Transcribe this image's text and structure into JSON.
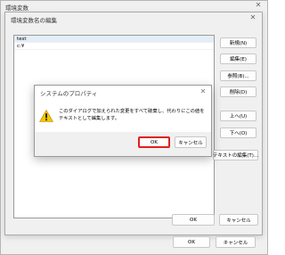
{
  "outer": {
    "title": "環境変数",
    "ok_label": "OK",
    "cancel_label": "キャンセル"
  },
  "inner": {
    "title": "環境変数名の編集",
    "list_items": [
      "test",
      "c:¥"
    ],
    "buttons": {
      "new": "新規(N)",
      "edit": "編集(E)",
      "browse": "参照(B)...",
      "delete": "削除(D)",
      "up": "上へ(U)",
      "down": "下へ(O)",
      "edit_text": "テキストの編集(T)..."
    },
    "ok_label": "OK",
    "cancel_label": "キャンセル"
  },
  "alert": {
    "title": "システムのプロパティ",
    "message": "このダイアログで加えられた変更をすべて破棄し、代わりにこの値をテキストとして編集します。",
    "ok_label": "OK",
    "cancel_label": "キャンセル"
  },
  "colors": {
    "highlight_border": "#e02020",
    "warning_fill": "#f5c400"
  },
  "icons": [
    "close-icon",
    "warning-icon"
  ]
}
